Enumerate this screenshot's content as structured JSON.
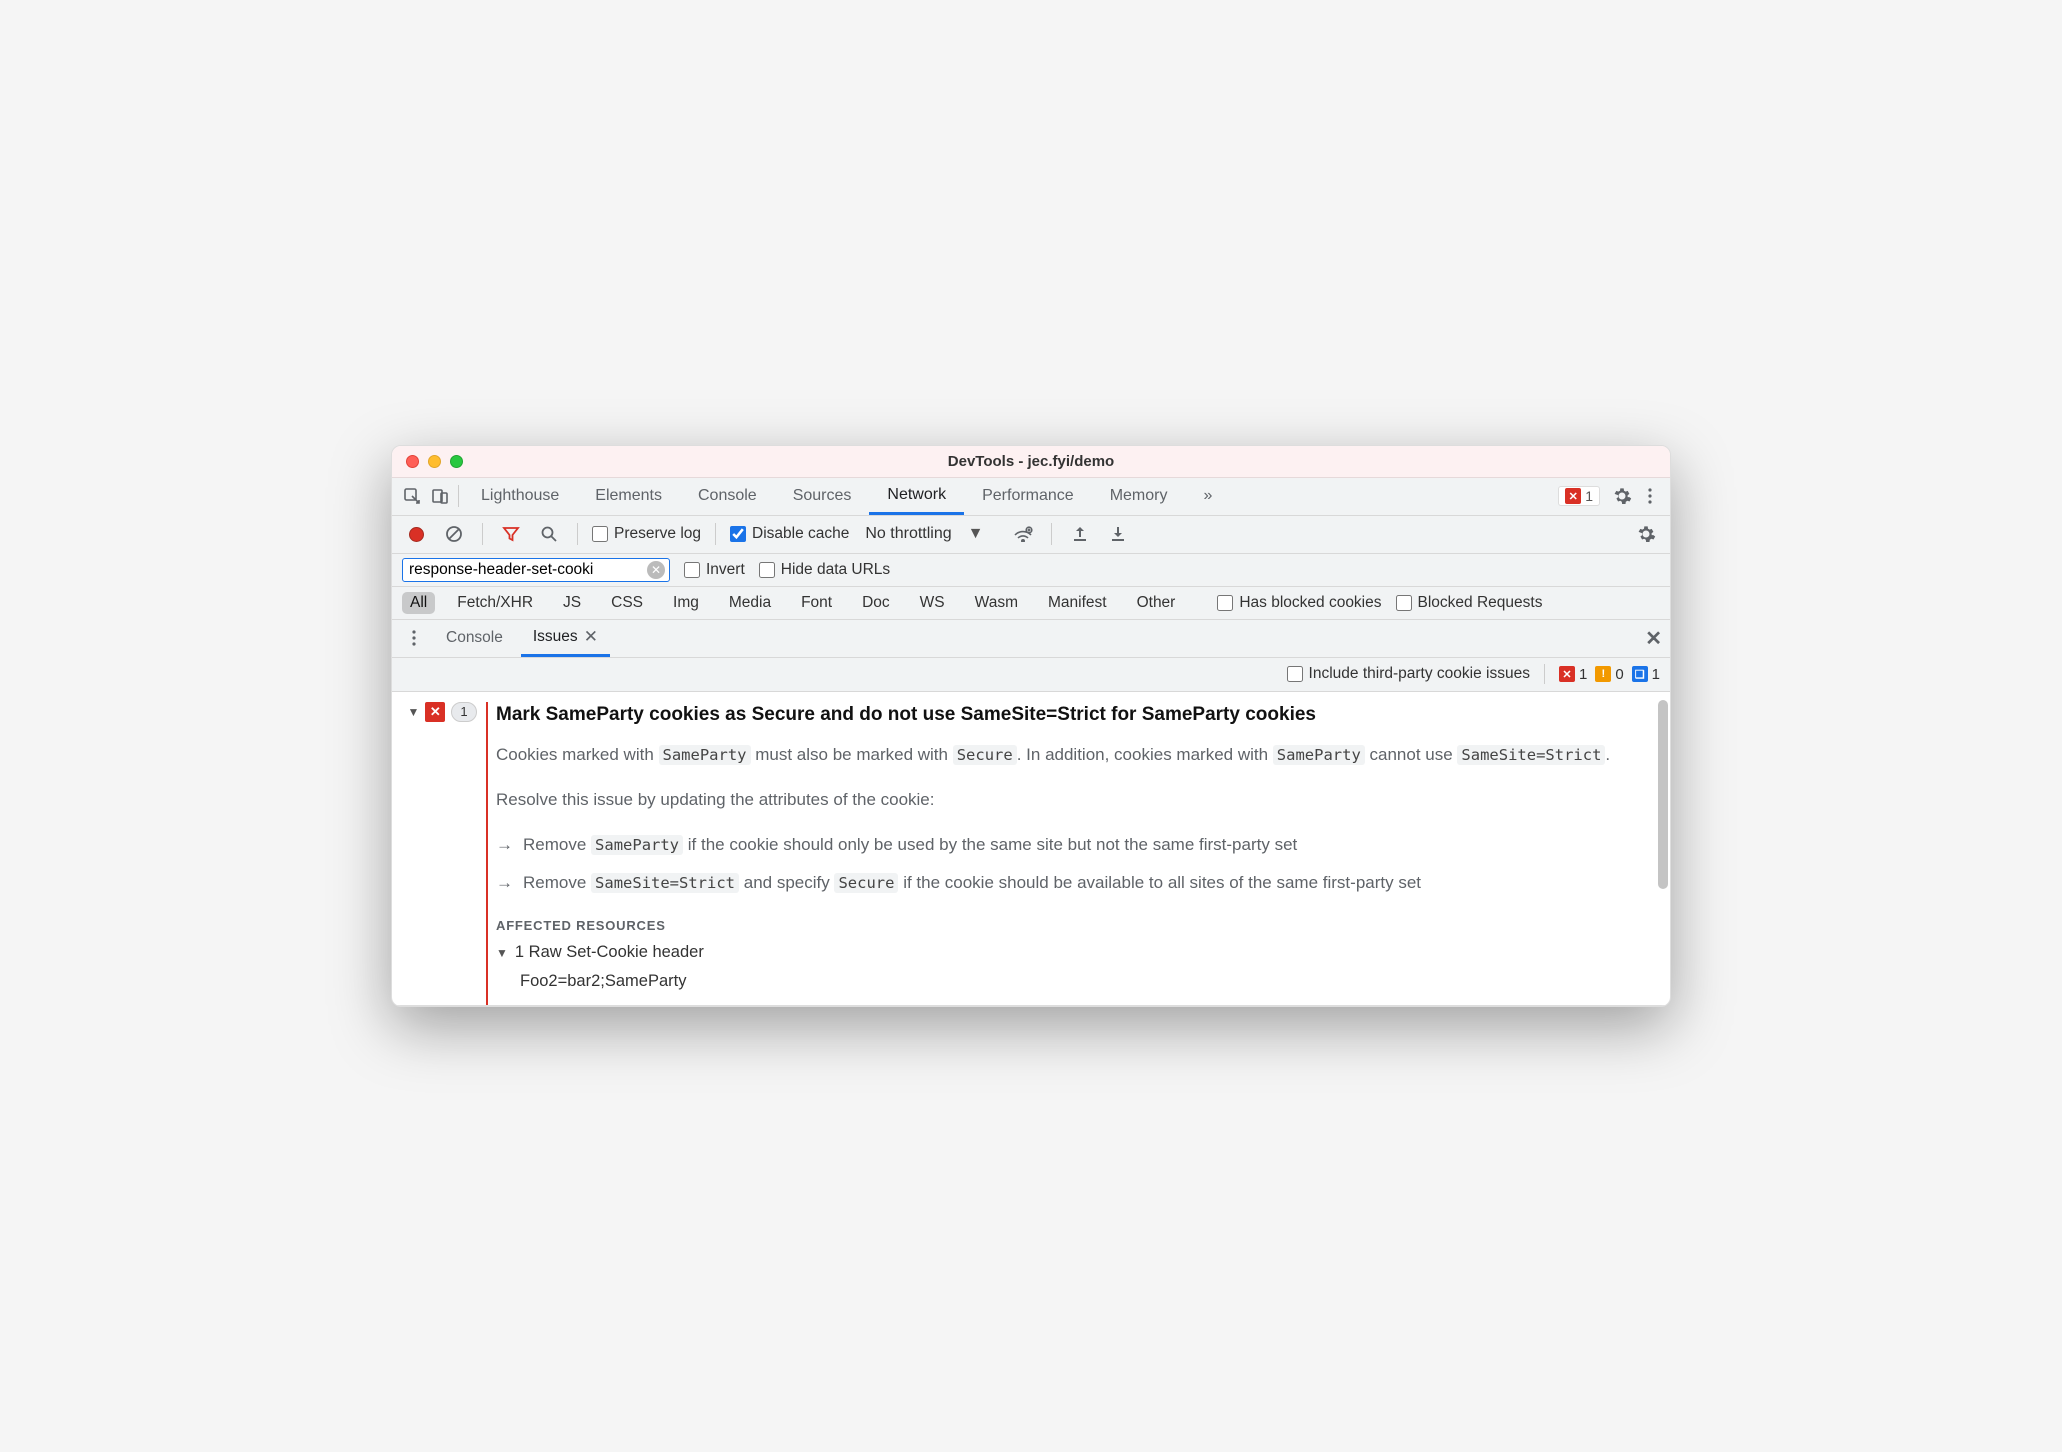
{
  "window": {
    "title": "DevTools - jec.fyi/demo"
  },
  "tabs": {
    "items": [
      "Lighthouse",
      "Elements",
      "Console",
      "Sources",
      "Network",
      "Performance",
      "Memory"
    ],
    "active": "Network",
    "overflow": "»",
    "error_count": "1"
  },
  "network_toolbar": {
    "preserve_log": "Preserve log",
    "disable_cache": "Disable cache",
    "throttle": "No throttling"
  },
  "filter_row": {
    "input_value": "response-header-set-cooki",
    "invert": "Invert",
    "hide_data_urls": "Hide data URLs"
  },
  "types": {
    "items": [
      "All",
      "Fetch/XHR",
      "JS",
      "CSS",
      "Img",
      "Media",
      "Font",
      "Doc",
      "WS",
      "Wasm",
      "Manifest",
      "Other"
    ],
    "active": "All",
    "has_blocked": "Has blocked cookies",
    "blocked_requests": "Blocked Requests"
  },
  "drawer": {
    "tabs": [
      "Console",
      "Issues"
    ],
    "active": "Issues"
  },
  "issues_bar": {
    "third_party": "Include third-party cookie issues",
    "errors": "1",
    "warnings": "0",
    "infos": "1"
  },
  "issue": {
    "count": "1",
    "title": "Mark SameParty cookies as Secure and do not use SameSite=Strict for SameParty cookies",
    "desc_part1": "Cookies marked with ",
    "code1": "SameParty",
    "desc_part2": " must also be marked with ",
    "code2": "Secure",
    "desc_part3": ". In addition, cookies marked with ",
    "code3": "SameParty",
    "desc_part4": " cannot use ",
    "code4": "SameSite=Strict",
    "desc_part5": ".",
    "resolve_intro": "Resolve this issue by updating the attributes of the cookie:",
    "bullet1_a": "Remove ",
    "bullet1_code": "SameParty",
    "bullet1_b": " if the cookie should only be used by the same site but not the same first-party set",
    "bullet2_a": "Remove ",
    "bullet2_code1": "SameSite=Strict",
    "bullet2_b": " and specify ",
    "bullet2_code2": "Secure",
    "bullet2_c": " if the cookie should be available to all sites of the same first-party set",
    "affected_heading": "AFFECTED RESOURCES",
    "resource_line": "1 Raw Set-Cookie header",
    "resource_detail": "Foo2=bar2;SameParty"
  }
}
